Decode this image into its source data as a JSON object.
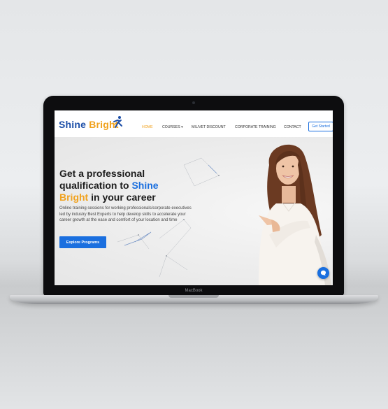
{
  "laptop": {
    "brand": "MacBook"
  },
  "site": {
    "logo": {
      "word1": "Shine",
      "word2": "Bright"
    },
    "nav": {
      "items": [
        {
          "label": "HOME",
          "active": true
        },
        {
          "label": "COURSES ▾",
          "active": false
        },
        {
          "label": "MIL/VET DISCOUNT",
          "active": false
        },
        {
          "label": "CORPORATE TRAINING",
          "active": false
        },
        {
          "label": "CONTACT",
          "active": false
        }
      ],
      "cta": "Get Started"
    },
    "hero": {
      "headline": {
        "part1": "Get a professional qualification to ",
        "highlight1": "Shine",
        "highlight2": "Bright",
        "part2": " in your career"
      },
      "description": "Online training sessions for working professionals/corporate executives led by industry Best Experts to help develop skills to accelerate your career growth at the ease and comfort of your location and time",
      "cta": "Explore Programs"
    },
    "colors": {
      "accent_blue": "#1a6fdf",
      "accent_orange": "#f0a21e",
      "logo_blue": "#1d4fa8"
    },
    "icons": {
      "chat": "chat-bubble-icon",
      "logo_mark": "running-figure-icon"
    }
  }
}
